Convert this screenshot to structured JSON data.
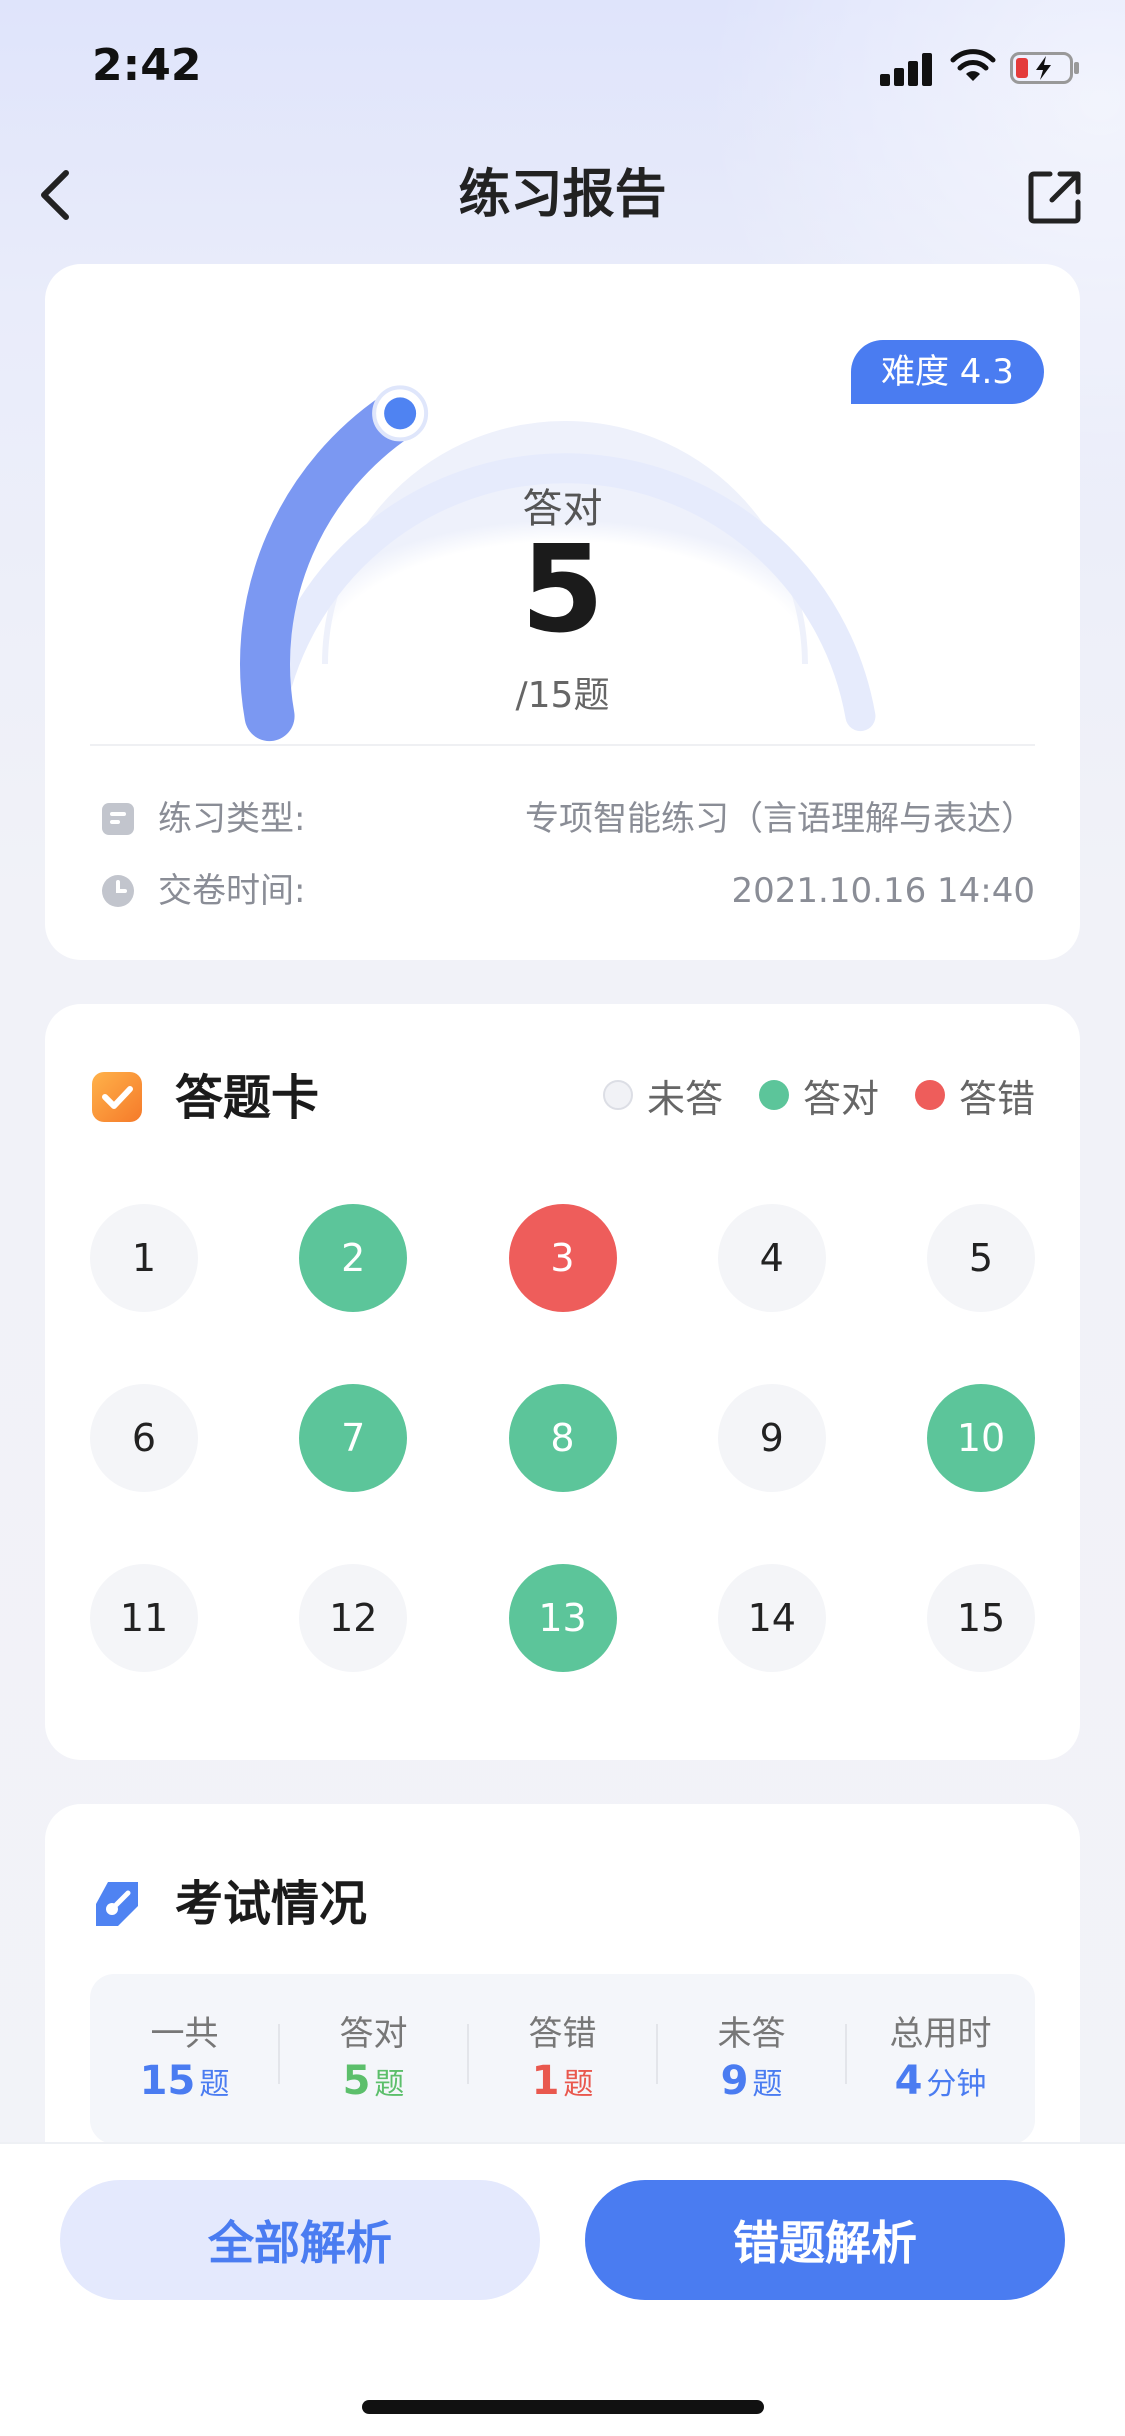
{
  "status_bar": {
    "time": "2:42"
  },
  "nav": {
    "title": "练习报告",
    "back_icon": "chevron-left-icon",
    "share_icon": "share-icon"
  },
  "score": {
    "difficulty": "难度 4.3",
    "label": "答对",
    "correct": "5",
    "total_label": "/15题",
    "progress_fraction": 0.3333
  },
  "info": {
    "type_label": "练习类型:",
    "type_value": "专项智能练习（言语理解与表达）",
    "time_label": "交卷时间:",
    "time_value": "2021.10.16 14:40"
  },
  "answer_card": {
    "title": "答题卡",
    "legend": {
      "unanswered": "未答",
      "correct": "答对",
      "wrong": "答错"
    },
    "questions": [
      {
        "n": "1",
        "s": "un"
      },
      {
        "n": "2",
        "s": "ok"
      },
      {
        "n": "3",
        "s": "bad"
      },
      {
        "n": "4",
        "s": "un"
      },
      {
        "n": "5",
        "s": "un"
      },
      {
        "n": "6",
        "s": "un"
      },
      {
        "n": "7",
        "s": "ok"
      },
      {
        "n": "8",
        "s": "ok"
      },
      {
        "n": "9",
        "s": "un"
      },
      {
        "n": "10",
        "s": "ok"
      },
      {
        "n": "11",
        "s": "un"
      },
      {
        "n": "12",
        "s": "un"
      },
      {
        "n": "13",
        "s": "ok"
      },
      {
        "n": "14",
        "s": "un"
      },
      {
        "n": "15",
        "s": "un"
      }
    ]
  },
  "exam": {
    "title": "考试情况",
    "stats": [
      {
        "label": "一共",
        "value": "15",
        "unit": "题",
        "color": "#4a7cf1"
      },
      {
        "label": "答对",
        "value": "5",
        "unit": "题",
        "color": "#5cbf6b"
      },
      {
        "label": "答错",
        "value": "1",
        "unit": "题",
        "color": "#e9584e"
      },
      {
        "label": "未答",
        "value": "9",
        "unit": "题",
        "color": "#4a7cf1"
      },
      {
        "label": "总用时",
        "value": "4",
        "unit": "分钟",
        "color": "#4a7cf1"
      }
    ]
  },
  "buttons": {
    "all_analysis": "全部解析",
    "wrong_analysis": "错题解析"
  },
  "colors": {
    "accent": "#4a7cf1",
    "correct": "#5cc59a",
    "wrong": "#ee5d5b",
    "unanswered": "#f4f5f8"
  }
}
